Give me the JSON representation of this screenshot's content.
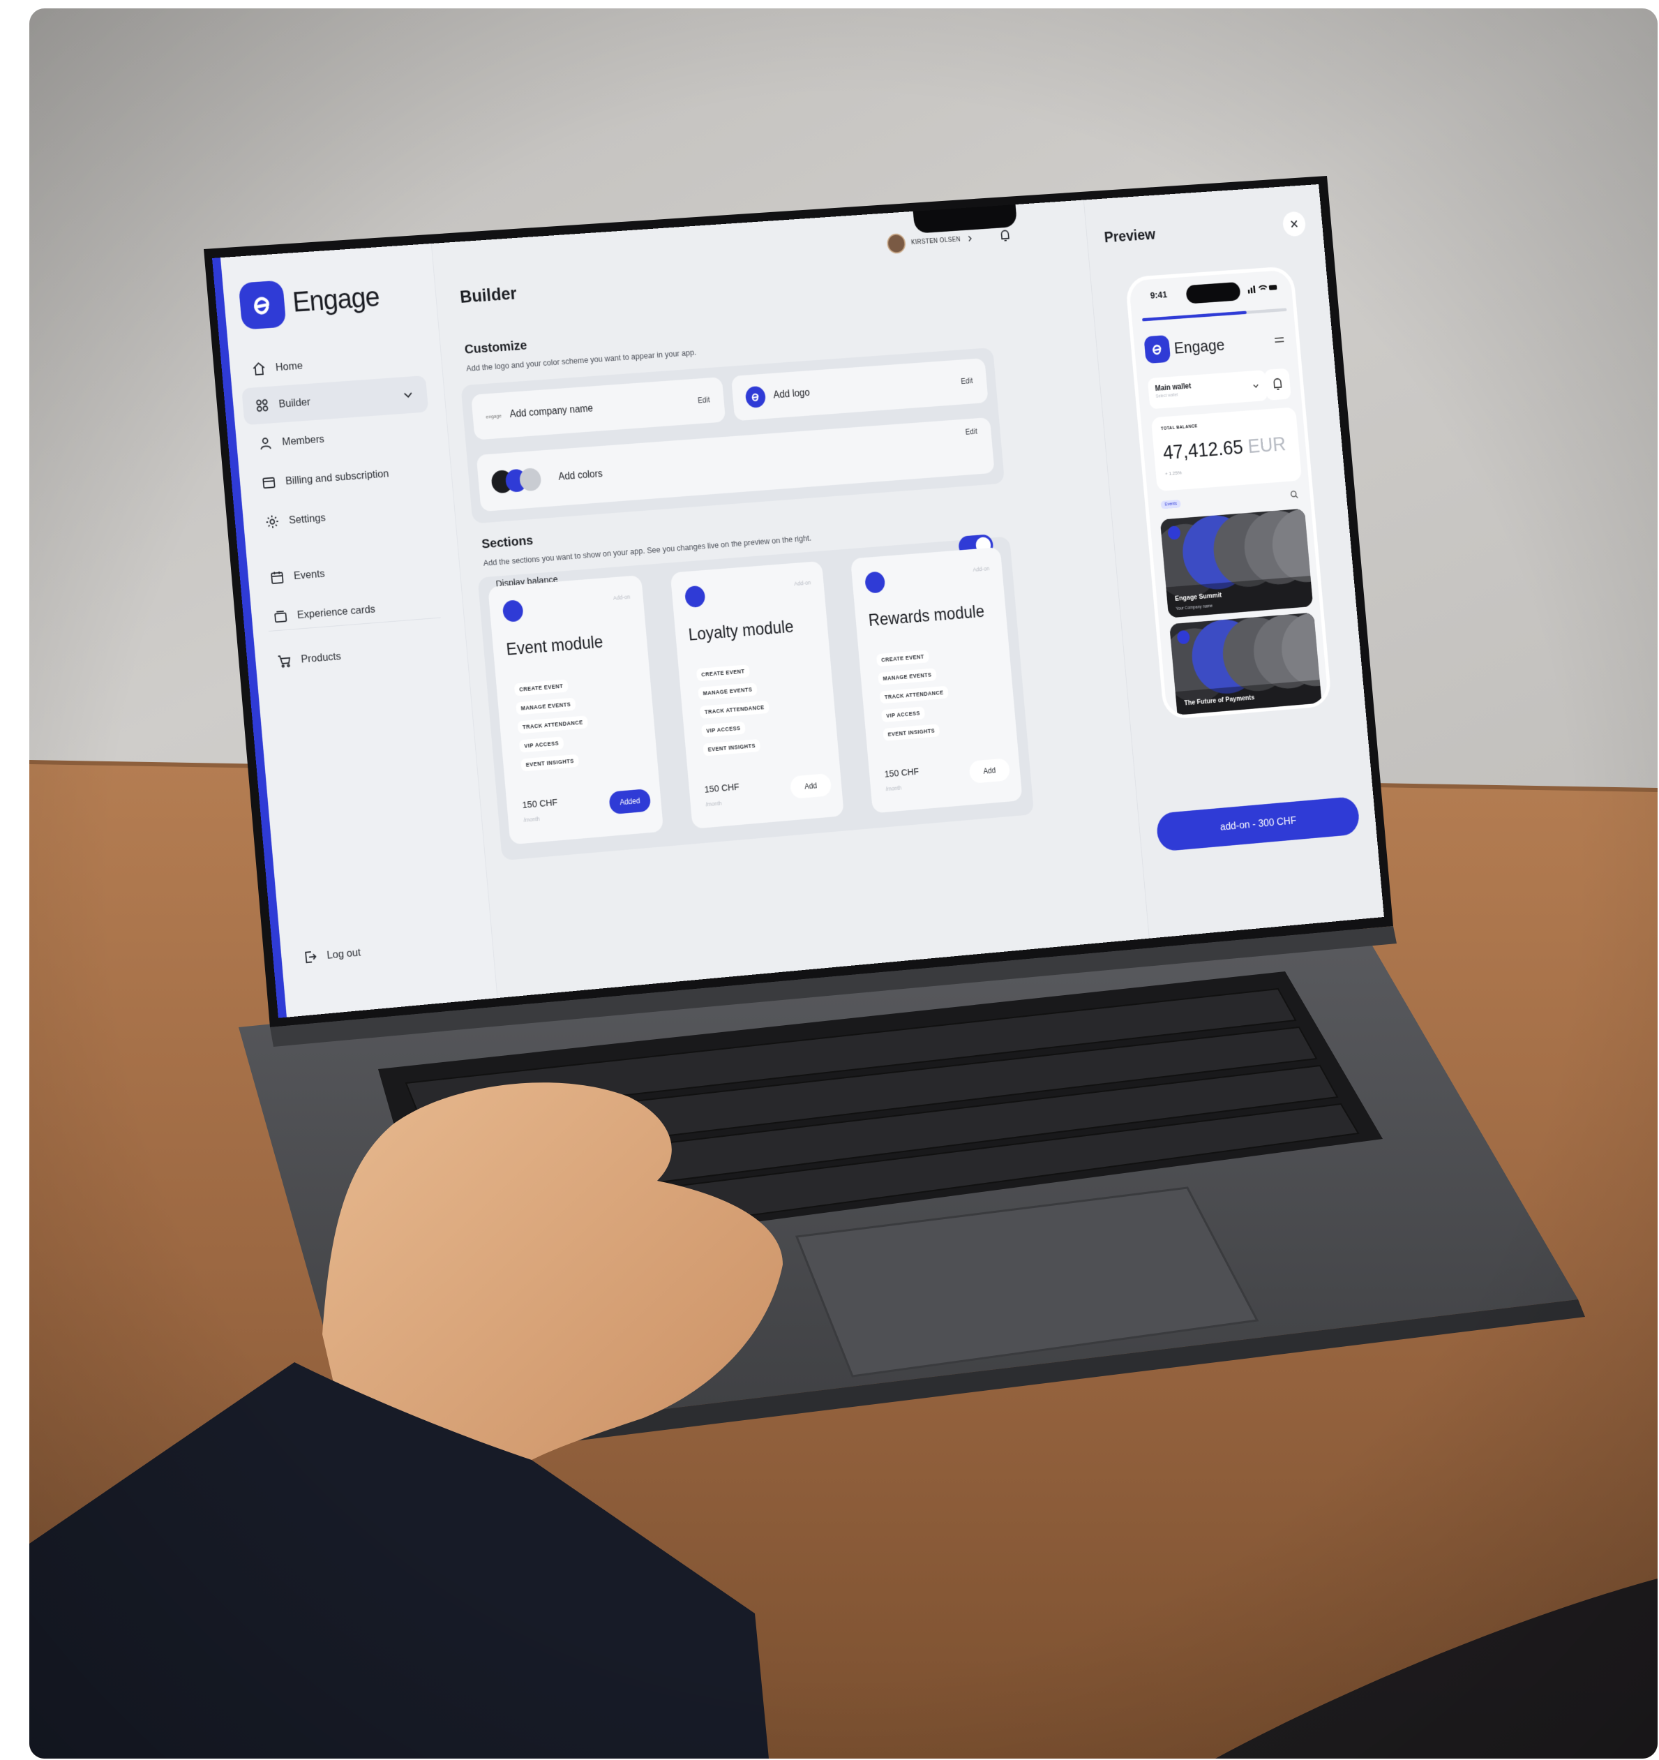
{
  "sidebar": {
    "brand": "Engage",
    "items": [
      {
        "label": "Home",
        "icon": "home-icon"
      },
      {
        "label": "Builder",
        "icon": "grid-icon"
      },
      {
        "label": "Members",
        "icon": "user-icon"
      },
      {
        "label": "Billing and subscription",
        "icon": "billing-icon"
      },
      {
        "label": "Settings",
        "icon": "gear-icon"
      },
      {
        "label": "Events",
        "icon": "calendar-icon"
      },
      {
        "label": "Experience cards",
        "icon": "card-icon"
      },
      {
        "label": "Products",
        "icon": "cart-icon"
      }
    ],
    "logout": "Log out"
  },
  "header": {
    "title": "Builder",
    "user_name": "KIRSTEN OLSEN"
  },
  "customize": {
    "title": "Customize",
    "description": "Add the logo and your color scheme you want to appear in your app.",
    "company_name_placeholder": "Add company name",
    "company_tag": "engage",
    "logo_label": "Add logo",
    "colors_label": "Add colors",
    "edit_label": "Edit",
    "swatches": [
      "#1b1c20",
      "#2f3bd6",
      "#c9ccd2"
    ]
  },
  "sections": {
    "title": "Sections",
    "description": "Add the sections you want to show on your app. See you changes live on the preview on the right.",
    "display_balance": "Display balance",
    "display_balance_on": true
  },
  "modules": [
    {
      "title": "Event module",
      "addon": "Add-on",
      "features": [
        "CREATE EVENT",
        "MANAGE EVENTS",
        "TRACK ATTENDANCE",
        "VIP ACCESS",
        "EVENT INSIGHTS"
      ],
      "price": "150 CHF",
      "period": "/month",
      "button": "Added",
      "added": true
    },
    {
      "title": "Loyalty module",
      "addon": "Add-on",
      "features": [
        "CREATE EVENT",
        "MANAGE EVENTS",
        "TRACK ATTENDANCE",
        "VIP ACCESS",
        "EVENT INSIGHTS"
      ],
      "price": "150 CHF",
      "period": "/month",
      "button": "Add",
      "added": false
    },
    {
      "title": "Rewards module",
      "addon": "Add-on",
      "features": [
        "CREATE EVENT",
        "MANAGE EVENTS",
        "TRACK ATTENDANCE",
        "VIP ACCESS",
        "EVENT INSIGHTS"
      ],
      "price": "150 CHF",
      "period": "/month",
      "button": "Add",
      "added": false
    }
  ],
  "preview": {
    "title": "Preview",
    "phone_time": "9:41",
    "brand": "Engage",
    "wallet": "Main wallet",
    "wallet_sub": "Select wallet",
    "balance_label": "TOTAL BALANCE",
    "balance_amount": "47,412.65",
    "balance_currency": "EUR",
    "balance_change": "+ 1.25%",
    "events_tag": "Events",
    "events": [
      {
        "title": "Engage Summit",
        "subtitle": "Your Company name"
      },
      {
        "title": "The Future of Payments",
        "subtitle": ""
      }
    ],
    "progress": 0.72,
    "cta": "add-on - 300 CHF"
  },
  "colors": {
    "accent": "#2f3bd6",
    "wall": "#c7c5c1",
    "desk": "#a8734a",
    "laptop": "#4a4b4e"
  }
}
